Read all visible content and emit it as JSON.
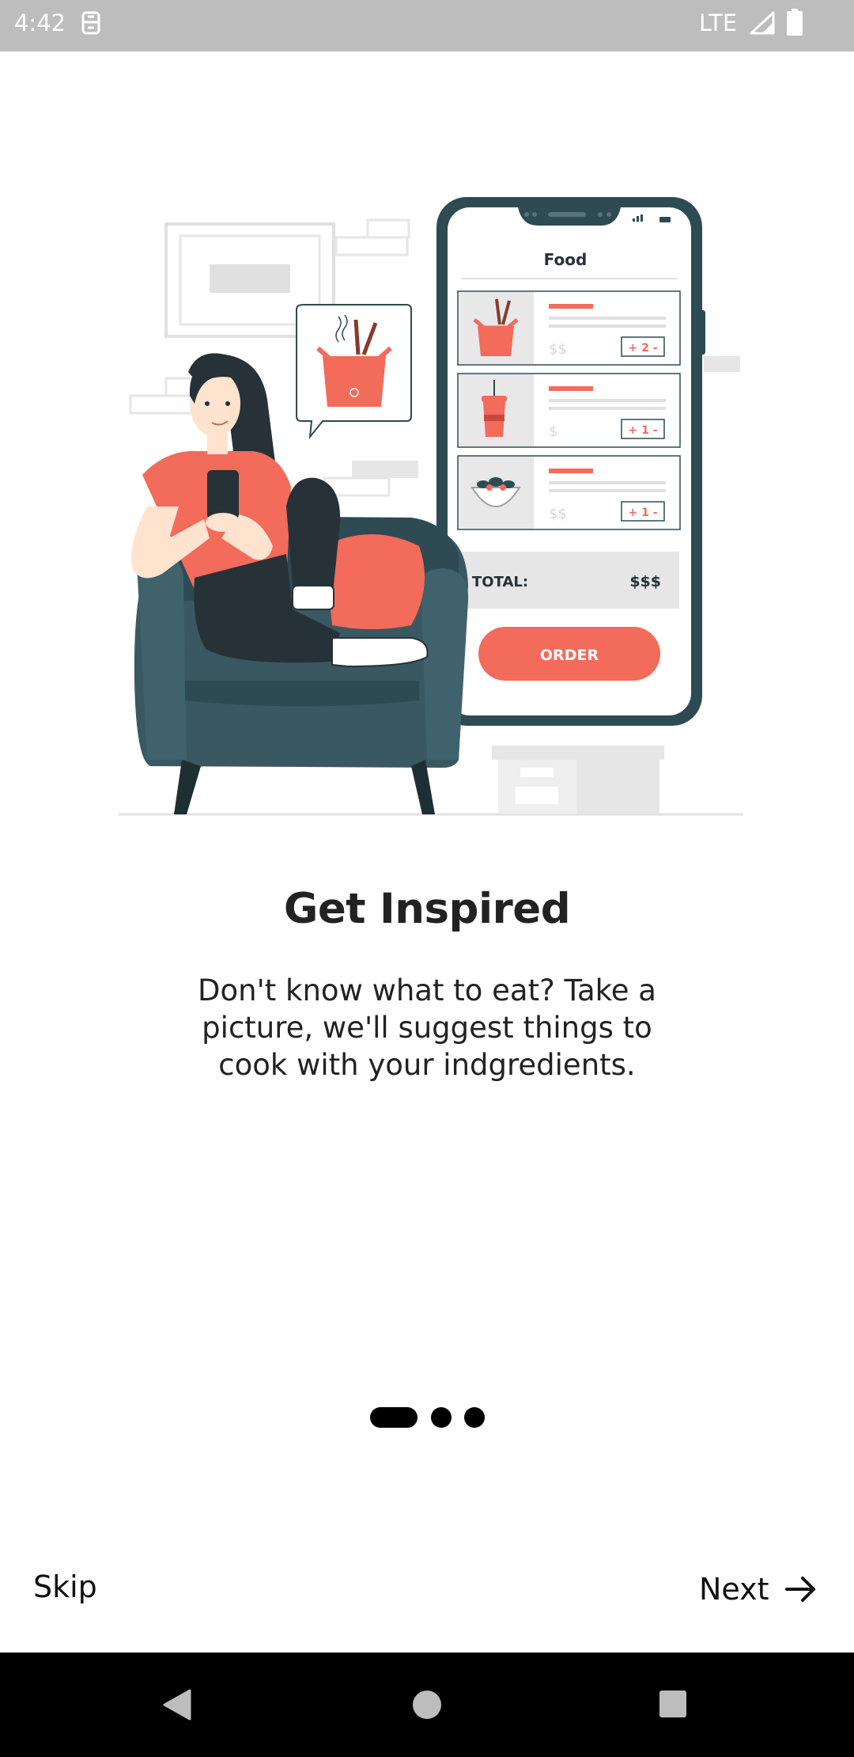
{
  "status_bar": {
    "time": "4:42",
    "network": "LTE",
    "icons": [
      "sim-icon",
      "signal-icon",
      "battery-icon"
    ]
  },
  "illustration": {
    "phone_header": "Food",
    "items": [
      {
        "price": "$$",
        "qty": "+ 2 -"
      },
      {
        "price": "$",
        "qty": "+ 1 -"
      },
      {
        "price": "$$",
        "qty": "+ 1 -"
      }
    ],
    "total_label": "TOTAL:",
    "total_value": "$$$",
    "order_label": "ORDER"
  },
  "onboarding": {
    "title": "Get Inspired",
    "description": "Don't know what to eat? Take a picture, we'll suggest things to cook with your indgredients.",
    "page_count": 3,
    "current_page": 1
  },
  "actions": {
    "skip_label": "Skip",
    "next_label": "Next"
  },
  "colors": {
    "accent": "#f26b5b",
    "dark_teal": "#2e4a52",
    "status_bar": "#bdbdbd"
  }
}
